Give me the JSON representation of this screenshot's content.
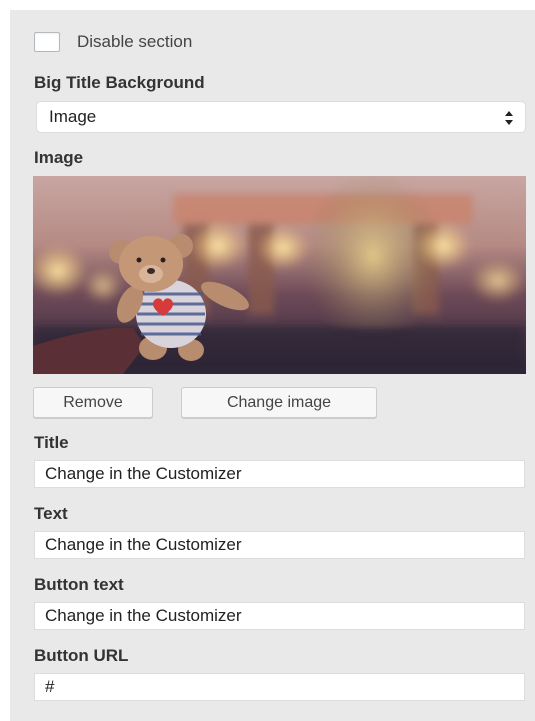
{
  "section": {
    "disable_label": "Disable section",
    "disable_checked": false
  },
  "background": {
    "label": "Big Title Background",
    "selected": "Image"
  },
  "image": {
    "label": "Image",
    "remove_label": "Remove",
    "change_label": "Change image"
  },
  "fields": {
    "title_label": "Title",
    "title_value": "Change in the Customizer",
    "text_label": "Text",
    "text_value": "Change in the Customizer",
    "button_text_label": "Button text",
    "button_text_value": "Change in the Customizer",
    "button_url_label": "Button URL",
    "button_url_value": "#"
  }
}
